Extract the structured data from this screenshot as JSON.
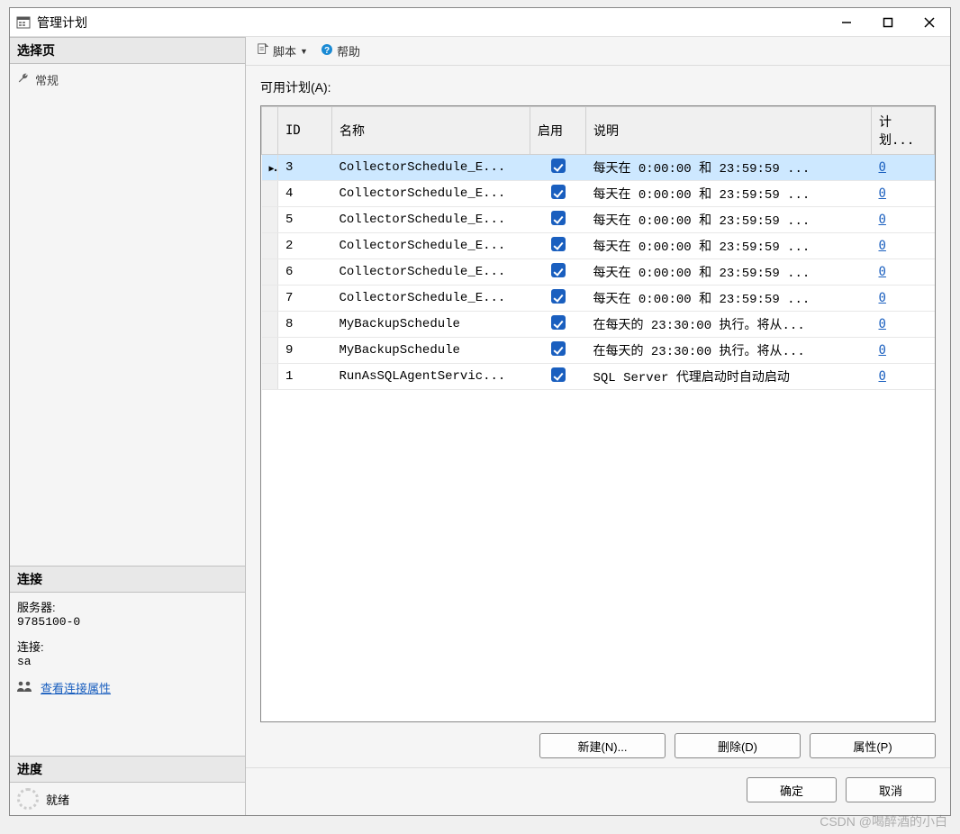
{
  "window": {
    "title": "管理计划"
  },
  "left": {
    "select_page_header": "选择页",
    "general_nav": "常规",
    "connection_header": "连接",
    "server_label": "服务器:",
    "server_value": "9785100-0",
    "conn_label": "连接:",
    "conn_value": "sa",
    "view_conn_props": "查看连接属性",
    "progress_header": "进度",
    "progress_status": "就绪"
  },
  "toolbar": {
    "script": "脚本",
    "help": "帮助"
  },
  "grid": {
    "label": "可用计划(A):",
    "headers": {
      "id": "ID",
      "name": "名称",
      "enabled": "启用",
      "desc": "说明",
      "count": "计划..."
    },
    "rows": [
      {
        "id": "3",
        "name": "CollectorSchedule_E...",
        "enabled": true,
        "desc": "每天在 0:00:00 和 23:59:59 ...",
        "count": "0",
        "selected": true
      },
      {
        "id": "4",
        "name": "CollectorSchedule_E...",
        "enabled": true,
        "desc": "每天在 0:00:00 和 23:59:59 ...",
        "count": "0"
      },
      {
        "id": "5",
        "name": "CollectorSchedule_E...",
        "enabled": true,
        "desc": "每天在 0:00:00 和 23:59:59 ...",
        "count": "0"
      },
      {
        "id": "2",
        "name": "CollectorSchedule_E...",
        "enabled": true,
        "desc": "每天在 0:00:00 和 23:59:59 ...",
        "count": "0"
      },
      {
        "id": "6",
        "name": "CollectorSchedule_E...",
        "enabled": true,
        "desc": "每天在 0:00:00 和 23:59:59 ...",
        "count": "0"
      },
      {
        "id": "7",
        "name": "CollectorSchedule_E...",
        "enabled": true,
        "desc": "每天在 0:00:00 和 23:59:59 ...",
        "count": "0"
      },
      {
        "id": "8",
        "name": "MyBackupSchedule",
        "enabled": true,
        "desc": "在每天的 23:30:00 执行。将从...",
        "count": "0"
      },
      {
        "id": "9",
        "name": "MyBackupSchedule",
        "enabled": true,
        "desc": "在每天的 23:30:00 执行。将从...",
        "count": "0"
      },
      {
        "id": "1",
        "name": "RunAsSQLAgentServic...",
        "enabled": true,
        "desc": "SQL Server 代理启动时自动启动",
        "count": "0"
      }
    ]
  },
  "buttons": {
    "new": "新建(N)...",
    "delete": "删除(D)",
    "props": "属性(P)",
    "ok": "确定",
    "cancel": "取消"
  },
  "watermark": "CSDN @喝醉酒的小白"
}
